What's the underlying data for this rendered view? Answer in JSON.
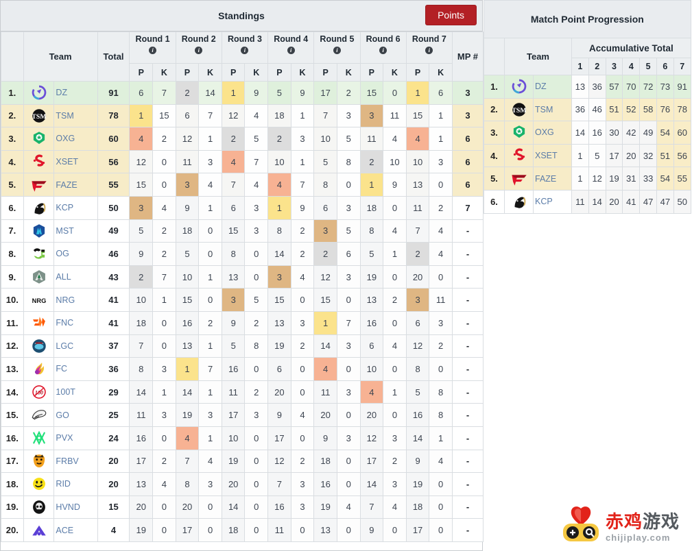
{
  "standings": {
    "title": "Standings",
    "points_button": "Points",
    "headers": {
      "team": "Team",
      "total": "Total",
      "mp": "MP #",
      "p": "P",
      "k": "K",
      "info_glyph": "i",
      "rounds": [
        "Round 1",
        "Round 2",
        "Round 3",
        "Round 4",
        "Round 5",
        "Round 6",
        "Round 7"
      ]
    },
    "rows": [
      {
        "rank": "1.",
        "team": "DZ",
        "logo": "dz-logo",
        "total": "91",
        "mp": "3",
        "rounds": [
          [
            "6",
            "7"
          ],
          [
            "2",
            "14"
          ],
          [
            "1",
            "9"
          ],
          [
            "5",
            "9"
          ],
          [
            "17",
            "2"
          ],
          [
            "15",
            "0"
          ],
          [
            "1",
            "6"
          ]
        ],
        "place": [
          null,
          2,
          1,
          null,
          null,
          null,
          1
        ],
        "tint": "green"
      },
      {
        "rank": "2.",
        "team": "TSM",
        "logo": "tsm-logo",
        "total": "78",
        "mp": "3",
        "rounds": [
          [
            "1",
            "15"
          ],
          [
            "6",
            "7"
          ],
          [
            "12",
            "4"
          ],
          [
            "18",
            "1"
          ],
          [
            "7",
            "3"
          ],
          [
            "3",
            "11"
          ],
          [
            "15",
            "1"
          ]
        ],
        "place": [
          1,
          null,
          null,
          null,
          null,
          3,
          null
        ],
        "tint": "cream"
      },
      {
        "rank": "3.",
        "team": "OXG",
        "logo": "oxg-logo",
        "total": "60",
        "mp": "6",
        "rounds": [
          [
            "4",
            "2"
          ],
          [
            "12",
            "1"
          ],
          [
            "2",
            "5"
          ],
          [
            "2",
            "3"
          ],
          [
            "10",
            "5"
          ],
          [
            "11",
            "4"
          ],
          [
            "4",
            "1"
          ]
        ],
        "place": [
          4,
          null,
          2,
          2,
          null,
          null,
          4
        ],
        "tint": "cream"
      },
      {
        "rank": "4.",
        "team": "XSET",
        "logo": "xset-logo",
        "total": "56",
        "mp": "6",
        "rounds": [
          [
            "12",
            "0"
          ],
          [
            "11",
            "3"
          ],
          [
            "4",
            "7"
          ],
          [
            "10",
            "1"
          ],
          [
            "5",
            "8"
          ],
          [
            "2",
            "10"
          ],
          [
            "10",
            "3"
          ]
        ],
        "place": [
          null,
          null,
          4,
          null,
          null,
          2,
          null
        ],
        "tint": "cream"
      },
      {
        "rank": "5.",
        "team": "FAZE",
        "logo": "faze-logo",
        "total": "55",
        "mp": "6",
        "rounds": [
          [
            "15",
            "0"
          ],
          [
            "3",
            "4"
          ],
          [
            "7",
            "4"
          ],
          [
            "4",
            "7"
          ],
          [
            "8",
            "0"
          ],
          [
            "1",
            "9"
          ],
          [
            "13",
            "0"
          ]
        ],
        "place": [
          null,
          3,
          null,
          4,
          null,
          1,
          null
        ],
        "tint": "cream"
      },
      {
        "rank": "6.",
        "team": "KCP",
        "logo": "kcp-logo",
        "total": "50",
        "mp": "7",
        "rounds": [
          [
            "3",
            "4"
          ],
          [
            "9",
            "1"
          ],
          [
            "6",
            "3"
          ],
          [
            "1",
            "9"
          ],
          [
            "6",
            "3"
          ],
          [
            "18",
            "0"
          ],
          [
            "11",
            "2"
          ]
        ],
        "place": [
          3,
          null,
          null,
          1,
          null,
          null,
          null
        ],
        "tint": "none"
      },
      {
        "rank": "7.",
        "team": "MST",
        "logo": "mst-logo",
        "total": "49",
        "mp": "-",
        "rounds": [
          [
            "5",
            "2"
          ],
          [
            "18",
            "0"
          ],
          [
            "15",
            "3"
          ],
          [
            "8",
            "2"
          ],
          [
            "3",
            "5"
          ],
          [
            "8",
            "4"
          ],
          [
            "7",
            "4"
          ]
        ],
        "place": [
          null,
          null,
          null,
          null,
          3,
          null,
          null
        ],
        "tint": "none"
      },
      {
        "rank": "8.",
        "team": "OG",
        "logo": "og-logo",
        "total": "46",
        "mp": "-",
        "rounds": [
          [
            "9",
            "2"
          ],
          [
            "5",
            "0"
          ],
          [
            "8",
            "0"
          ],
          [
            "14",
            "2"
          ],
          [
            "2",
            "6"
          ],
          [
            "5",
            "1"
          ],
          [
            "2",
            "4"
          ]
        ],
        "place": [
          null,
          null,
          null,
          null,
          2,
          null,
          2
        ],
        "tint": "none"
      },
      {
        "rank": "9.",
        "team": "ALL",
        "logo": "all-logo",
        "total": "43",
        "mp": "-",
        "rounds": [
          [
            "2",
            "7"
          ],
          [
            "10",
            "1"
          ],
          [
            "13",
            "0"
          ],
          [
            "3",
            "4"
          ],
          [
            "12",
            "3"
          ],
          [
            "19",
            "0"
          ],
          [
            "20",
            "0"
          ]
        ],
        "place": [
          2,
          null,
          null,
          3,
          null,
          null,
          null
        ],
        "tint": "none"
      },
      {
        "rank": "10.",
        "team": "NRG",
        "logo": "nrg-logo",
        "total": "41",
        "mp": "-",
        "rounds": [
          [
            "10",
            "1"
          ],
          [
            "15",
            "0"
          ],
          [
            "3",
            "5"
          ],
          [
            "15",
            "0"
          ],
          [
            "15",
            "0"
          ],
          [
            "13",
            "2"
          ],
          [
            "3",
            "11"
          ]
        ],
        "place": [
          null,
          null,
          3,
          null,
          null,
          null,
          3
        ],
        "tint": "none"
      },
      {
        "rank": "11.",
        "team": "FNC",
        "logo": "fnc-logo",
        "total": "41",
        "mp": "-",
        "rounds": [
          [
            "18",
            "0"
          ],
          [
            "16",
            "2"
          ],
          [
            "9",
            "2"
          ],
          [
            "13",
            "3"
          ],
          [
            "1",
            "7"
          ],
          [
            "16",
            "0"
          ],
          [
            "6",
            "3"
          ]
        ],
        "place": [
          null,
          null,
          null,
          null,
          1,
          null,
          null
        ],
        "tint": "none"
      },
      {
        "rank": "12.",
        "team": "LGC",
        "logo": "lgc-logo",
        "total": "37",
        "mp": "-",
        "rounds": [
          [
            "7",
            "0"
          ],
          [
            "13",
            "1"
          ],
          [
            "5",
            "8"
          ],
          [
            "19",
            "2"
          ],
          [
            "14",
            "3"
          ],
          [
            "6",
            "4"
          ],
          [
            "12",
            "2"
          ]
        ],
        "place": [
          null,
          null,
          null,
          null,
          null,
          null,
          null
        ],
        "tint": "none"
      },
      {
        "rank": "13.",
        "team": "FC",
        "logo": "fc-logo",
        "total": "36",
        "mp": "-",
        "rounds": [
          [
            "8",
            "3"
          ],
          [
            "1",
            "7"
          ],
          [
            "16",
            "0"
          ],
          [
            "6",
            "0"
          ],
          [
            "4",
            "0"
          ],
          [
            "10",
            "0"
          ],
          [
            "8",
            "0"
          ]
        ],
        "place": [
          null,
          1,
          null,
          null,
          4,
          null,
          null
        ],
        "tint": "none"
      },
      {
        "rank": "14.",
        "team": "100T",
        "logo": "100t-logo",
        "total": "29",
        "mp": "-",
        "rounds": [
          [
            "14",
            "1"
          ],
          [
            "14",
            "1"
          ],
          [
            "11",
            "2"
          ],
          [
            "20",
            "0"
          ],
          [
            "11",
            "3"
          ],
          [
            "4",
            "1"
          ],
          [
            "5",
            "8"
          ]
        ],
        "place": [
          null,
          null,
          null,
          null,
          null,
          4,
          null
        ],
        "tint": "none"
      },
      {
        "rank": "15.",
        "team": "GO",
        "logo": "go-logo",
        "total": "25",
        "mp": "-",
        "rounds": [
          [
            "11",
            "3"
          ],
          [
            "19",
            "3"
          ],
          [
            "17",
            "3"
          ],
          [
            "9",
            "4"
          ],
          [
            "20",
            "0"
          ],
          [
            "20",
            "0"
          ],
          [
            "16",
            "8"
          ]
        ],
        "place": [
          null,
          null,
          null,
          null,
          null,
          null,
          null
        ],
        "tint": "none"
      },
      {
        "rank": "16.",
        "team": "PVX",
        "logo": "pvx-logo",
        "total": "24",
        "mp": "-",
        "rounds": [
          [
            "16",
            "0"
          ],
          [
            "4",
            "1"
          ],
          [
            "10",
            "0"
          ],
          [
            "17",
            "0"
          ],
          [
            "9",
            "3"
          ],
          [
            "12",
            "3"
          ],
          [
            "14",
            "1"
          ]
        ],
        "place": [
          null,
          4,
          null,
          null,
          null,
          null,
          null
        ],
        "tint": "none"
      },
      {
        "rank": "17.",
        "team": "FRBV",
        "logo": "frbv-logo",
        "total": "20",
        "mp": "-",
        "rounds": [
          [
            "17",
            "2"
          ],
          [
            "7",
            "4"
          ],
          [
            "19",
            "0"
          ],
          [
            "12",
            "2"
          ],
          [
            "18",
            "0"
          ],
          [
            "17",
            "2"
          ],
          [
            "9",
            "4"
          ]
        ],
        "place": [
          null,
          null,
          null,
          null,
          null,
          null,
          null
        ],
        "tint": "none"
      },
      {
        "rank": "18.",
        "team": "RID",
        "logo": "rid-logo",
        "total": "20",
        "mp": "-",
        "rounds": [
          [
            "13",
            "4"
          ],
          [
            "8",
            "3"
          ],
          [
            "20",
            "0"
          ],
          [
            "7",
            "3"
          ],
          [
            "16",
            "0"
          ],
          [
            "14",
            "3"
          ],
          [
            "19",
            "0"
          ]
        ],
        "place": [
          null,
          null,
          null,
          null,
          null,
          null,
          null
        ],
        "tint": "none"
      },
      {
        "rank": "19.",
        "team": "HVND",
        "logo": "hvnd-logo",
        "total": "15",
        "mp": "-",
        "rounds": [
          [
            "20",
            "0"
          ],
          [
            "20",
            "0"
          ],
          [
            "14",
            "0"
          ],
          [
            "16",
            "3"
          ],
          [
            "19",
            "4"
          ],
          [
            "7",
            "4"
          ],
          [
            "18",
            "0"
          ]
        ],
        "place": [
          null,
          null,
          null,
          null,
          null,
          null,
          null
        ],
        "tint": "none"
      },
      {
        "rank": "20.",
        "team": "ACE",
        "logo": "ace-logo",
        "total": "4",
        "mp": "-",
        "rounds": [
          [
            "19",
            "0"
          ],
          [
            "17",
            "0"
          ],
          [
            "18",
            "0"
          ],
          [
            "11",
            "0"
          ],
          [
            "13",
            "0"
          ],
          [
            "9",
            "0"
          ],
          [
            "17",
            "0"
          ]
        ],
        "place": [
          null,
          null,
          null,
          null,
          null,
          null,
          null
        ],
        "tint": "none"
      }
    ]
  },
  "match_point_progression": {
    "title": "Match Point Progression",
    "headers": {
      "team": "Team",
      "accumulative_total": "Accumulative Total",
      "columns": [
        "1",
        "2",
        "3",
        "4",
        "5",
        "6",
        "7"
      ]
    },
    "rows": [
      {
        "rank": "1.",
        "team": "DZ",
        "logo": "dz-logo",
        "values": [
          "13",
          "36",
          "57",
          "70",
          "72",
          "73",
          "91"
        ],
        "tint": "green",
        "highlight_from": 3
      },
      {
        "rank": "2.",
        "team": "TSM",
        "logo": "tsm-logo",
        "values": [
          "36",
          "46",
          "51",
          "52",
          "58",
          "76",
          "78"
        ],
        "tint": "cream",
        "highlight_from": 3
      },
      {
        "rank": "3.",
        "team": "OXG",
        "logo": "oxg-logo",
        "values": [
          "14",
          "16",
          "30",
          "42",
          "49",
          "54",
          "60"
        ],
        "tint": "cream",
        "highlight_from": 6
      },
      {
        "rank": "4.",
        "team": "XSET",
        "logo": "xset-logo",
        "values": [
          "1",
          "5",
          "17",
          "20",
          "32",
          "51",
          "56"
        ],
        "tint": "cream",
        "highlight_from": 6
      },
      {
        "rank": "5.",
        "team": "FAZE",
        "logo": "faze-logo",
        "values": [
          "1",
          "12",
          "19",
          "31",
          "33",
          "54",
          "55"
        ],
        "tint": "cream",
        "highlight_from": 6
      },
      {
        "rank": "6.",
        "team": "KCP",
        "logo": "kcp-logo",
        "values": [
          "11",
          "14",
          "20",
          "41",
          "47",
          "47",
          "50"
        ],
        "tint": "none",
        "highlight_from": 0
      }
    ]
  },
  "watermark": {
    "brand_cn": "赤鸡游戏",
    "domain": "chijiplay.com",
    "icon": "gamepad-heart-icon"
  },
  "colors": {
    "points_button": "#b32025",
    "place1": "#fbe38c",
    "place2": "#dddddd",
    "place3": "#dfb683",
    "place4": "#f7b293",
    "tint_green": "#dff0dc",
    "tint_cream": "#f7ecc8",
    "header_bg": "#eceff1",
    "team_text": "#5b7ca8",
    "watermark_red": "#e2231a"
  }
}
